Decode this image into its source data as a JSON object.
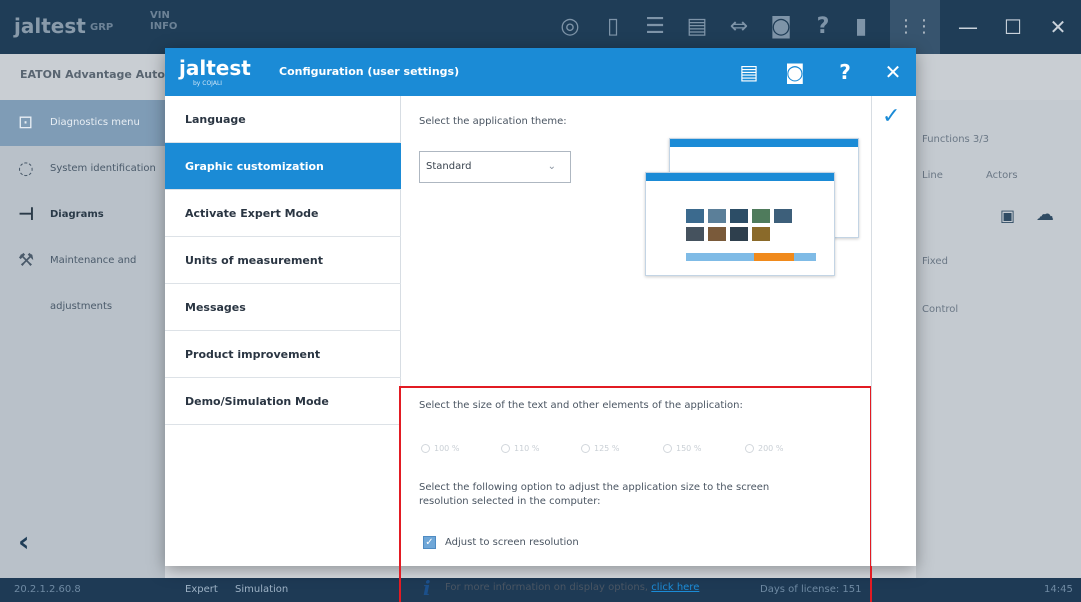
{
  "app": {
    "brand": "jaltest",
    "brand_sub": "GRP",
    "vin_label": "VIN\nINFO",
    "breadcrumb": "EATON Advantage Autom",
    "status_left": "20.2.1.2.60.8",
    "status_mode_expert": "Expert",
    "status_mode_sim": "Simulation",
    "status_license": "Days of license: 151",
    "status_time": "14:45"
  },
  "leftnav": {
    "items": [
      {
        "label": "Diagnostics menu"
      },
      {
        "label": "System identification"
      },
      {
        "label": "Diagrams"
      },
      {
        "label": "Maintenance and adjustments"
      }
    ]
  },
  "background_right": {
    "items": [
      "Functions 3/3",
      "Line",
      "Actors",
      "Fixed",
      "Control"
    ]
  },
  "modal": {
    "logo": "jaltest",
    "logo_sub": "by COJALI",
    "title": "Configuration (user settings)",
    "menu": [
      {
        "label": "Language"
      },
      {
        "label": "Graphic customization"
      },
      {
        "label": "Activate Expert Mode"
      },
      {
        "label": "Units of measurement"
      },
      {
        "label": "Messages"
      },
      {
        "label": "Product improvement"
      },
      {
        "label": "Demo/Simulation Mode"
      }
    ],
    "active_menu_index": 1,
    "theme_label": "Select the application theme:",
    "theme_value": "Standard",
    "size_label": "Select the size of the text and other elements of the application:",
    "size_options": [
      "100 %",
      "110 %",
      "125 %",
      "150 %",
      "200 %"
    ],
    "resolution_label_1": "Select the following option to adjust the application size to the screen",
    "resolution_label_2": "resolution selected in the computer:",
    "adjust_label": "Adjust to screen resolution",
    "adjust_checked": true,
    "info_text": "For more information on display options, ",
    "info_link": "click here"
  },
  "colors": {
    "accent": "#1b8bd6",
    "highlight_box": "#e21b23",
    "topbar": "#1f3d57"
  }
}
